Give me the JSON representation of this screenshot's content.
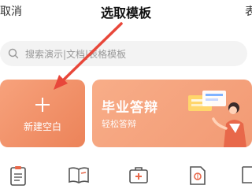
{
  "header": {
    "cancel_label": "取消",
    "title": "选取模板",
    "right_label": "表"
  },
  "search": {
    "placeholder": "搜索演示|文档|表格模板"
  },
  "cards": {
    "blank": {
      "label": "新建空白",
      "icon": "plus-icon"
    },
    "defense": {
      "title": "毕业答辩",
      "subtitle": "轻松答辩"
    }
  },
  "categories": [
    {
      "icon": "clipboard-icon"
    },
    {
      "icon": "book-icon"
    },
    {
      "icon": "medical-kit-icon"
    },
    {
      "icon": "certificate-icon"
    },
    {
      "icon": "frame-icon"
    }
  ],
  "colors": {
    "blank_card": "#ec8359",
    "defense_card": "#f29a74",
    "accent": "#e8684a",
    "arrow": "#e8473a"
  }
}
